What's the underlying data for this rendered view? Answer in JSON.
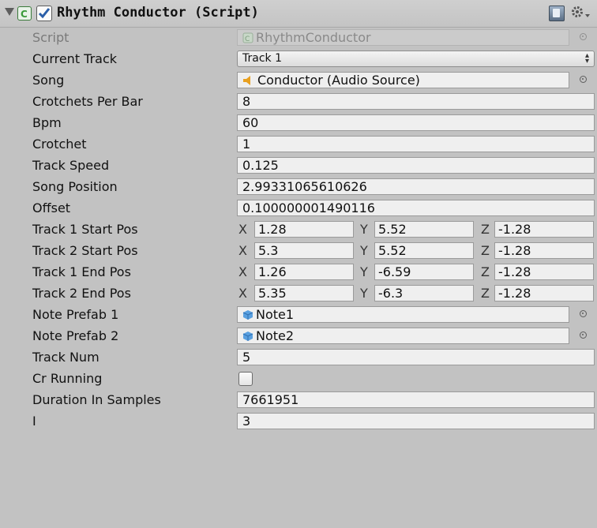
{
  "component": {
    "title": "Rhythm Conductor (Script)"
  },
  "fields": {
    "script": {
      "label": "Script",
      "value": "RhythmConductor"
    },
    "current_track": {
      "label": "Current Track",
      "value": "Track 1"
    },
    "song": {
      "label": "Song",
      "value": "Conductor (Audio Source)"
    },
    "crotchets_per_bar": {
      "label": "Crotchets Per Bar",
      "value": "8"
    },
    "bpm": {
      "label": "Bpm",
      "value": "60"
    },
    "crotchet": {
      "label": "Crotchet",
      "value": "1"
    },
    "track_speed": {
      "label": "Track Speed",
      "value": "0.125"
    },
    "song_position": {
      "label": "Song Position",
      "value": "2.99331065610626"
    },
    "offset": {
      "label": "Offset",
      "value": "0.100000001490116"
    },
    "track1_start": {
      "label": "Track 1 Start Pos",
      "x": "1.28",
      "y": "5.52",
      "z": "-1.28"
    },
    "track2_start": {
      "label": "Track 2 Start Pos",
      "x": "5.3",
      "y": "5.52",
      "z": "-1.28"
    },
    "track1_end": {
      "label": "Track 1 End Pos",
      "x": "1.26",
      "y": "-6.59",
      "z": "-1.28"
    },
    "track2_end": {
      "label": "Track 2 End Pos",
      "x": "5.35",
      "y": "-6.3",
      "z": "-1.28"
    },
    "note_prefab_1": {
      "label": "Note Prefab 1",
      "value": "Note1"
    },
    "note_prefab_2": {
      "label": "Note Prefab 2",
      "value": "Note2"
    },
    "track_num": {
      "label": "Track Num",
      "value": "5"
    },
    "cr_running": {
      "label": "Cr Running",
      "checked": false
    },
    "duration_in_samples": {
      "label": "Duration In Samples",
      "value": "7661951"
    },
    "i": {
      "label": "I",
      "value": "3"
    }
  },
  "axes": {
    "x": "X",
    "y": "Y",
    "z": "Z"
  },
  "popup_arrows": "▴▾",
  "colors": {
    "audio_icon": "#e8a020",
    "prefab_icon": "#5aa0e0",
    "script_icon": "#3a9a3a",
    "checkmark": "#2a5ea8"
  }
}
